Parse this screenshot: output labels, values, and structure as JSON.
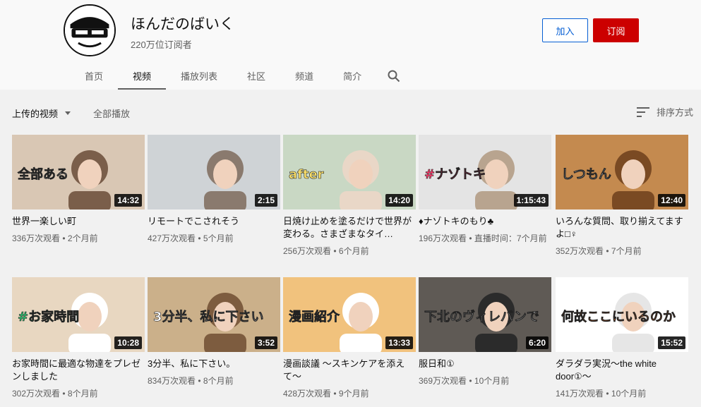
{
  "channel": {
    "name": "ほんだのばいく",
    "subscribers": "220万位订阅者",
    "join_label": "加入",
    "subscribe_label": "订阅"
  },
  "tabs": [
    "首页",
    "视频",
    "播放列表",
    "社区",
    "频道",
    "简介"
  ],
  "toolbar": {
    "uploads_label": "上传的视频",
    "play_all_label": "全部播放",
    "sort_label": "排序方式"
  },
  "videos": [
    {
      "title": "世界一楽しい町",
      "views": "336万次观看",
      "age": "2个月前",
      "duration": "14:32",
      "overlay": "全部ある"
    },
    {
      "title": "リモートでこされそう",
      "views": "427万次观看",
      "age": "5个月前",
      "duration": "2:15",
      "overlay": ""
    },
    {
      "title": "日焼け止めを塗るだけで世界が変わる。さまざまなタイ…",
      "views": "256万次观看",
      "age": "6个月前",
      "duration": "14:20",
      "overlay": "after"
    },
    {
      "title": "♦ナゾトキのもり♣",
      "views": "196万次观看",
      "age": "直播时间：7个月前",
      "duration": "1:15:43",
      "overlay": "#ナゾトキ"
    },
    {
      "title": "いろんな質問、取り揃えてますよ□♀",
      "views": "352万次观看",
      "age": "7个月前",
      "duration": "12:40",
      "overlay": "しつもん"
    },
    {
      "title": "お家時間に最適な物達をプレゼンしました",
      "views": "302万次观看",
      "age": "8个月前",
      "duration": "10:28",
      "overlay": "#お家時間"
    },
    {
      "title": "3分半、私に下さい。",
      "views": "834万次观看",
      "age": "8个月前",
      "duration": "3:52",
      "overlay": "3分半、私に下さい"
    },
    {
      "title": "漫画談議 〜スキンケアを添えて〜",
      "views": "428万次观看",
      "age": "9个月前",
      "duration": "13:33",
      "overlay": "漫画紹介"
    },
    {
      "title": "服日和①",
      "views": "369万次观看",
      "age": "10个月前",
      "duration": "6:20",
      "overlay": "下北のヴィレバンで"
    },
    {
      "title": "ダラダラ実況〜the white door①〜",
      "views": "141万次观看",
      "age": "10个月前",
      "duration": "15:52",
      "overlay": "何故ここにいるのか"
    }
  ]
}
